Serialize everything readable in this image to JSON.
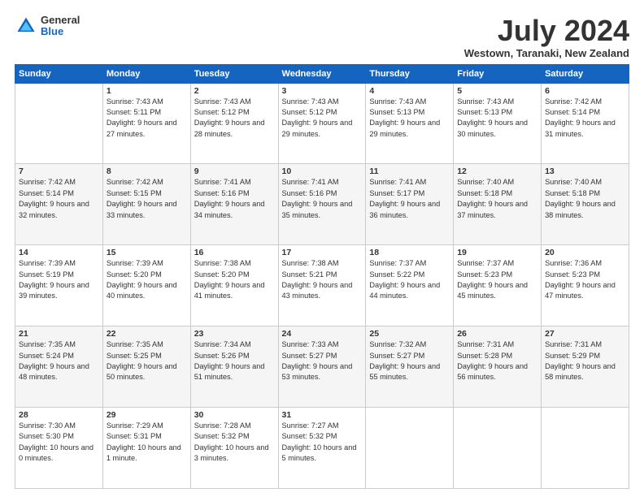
{
  "logo": {
    "general": "General",
    "blue": "Blue"
  },
  "title": "July 2024",
  "location": "Westown, Taranaki, New Zealand",
  "days_of_week": [
    "Sunday",
    "Monday",
    "Tuesday",
    "Wednesday",
    "Thursday",
    "Friday",
    "Saturday"
  ],
  "weeks": [
    [
      {
        "day": "",
        "sunrise": "",
        "sunset": "",
        "daylight": ""
      },
      {
        "day": "1",
        "sunrise": "Sunrise: 7:43 AM",
        "sunset": "Sunset: 5:11 PM",
        "daylight": "Daylight: 9 hours and 27 minutes."
      },
      {
        "day": "2",
        "sunrise": "Sunrise: 7:43 AM",
        "sunset": "Sunset: 5:12 PM",
        "daylight": "Daylight: 9 hours and 28 minutes."
      },
      {
        "day": "3",
        "sunrise": "Sunrise: 7:43 AM",
        "sunset": "Sunset: 5:12 PM",
        "daylight": "Daylight: 9 hours and 29 minutes."
      },
      {
        "day": "4",
        "sunrise": "Sunrise: 7:43 AM",
        "sunset": "Sunset: 5:13 PM",
        "daylight": "Daylight: 9 hours and 29 minutes."
      },
      {
        "day": "5",
        "sunrise": "Sunrise: 7:43 AM",
        "sunset": "Sunset: 5:13 PM",
        "daylight": "Daylight: 9 hours and 30 minutes."
      },
      {
        "day": "6",
        "sunrise": "Sunrise: 7:42 AM",
        "sunset": "Sunset: 5:14 PM",
        "daylight": "Daylight: 9 hours and 31 minutes."
      }
    ],
    [
      {
        "day": "7",
        "sunrise": "Sunrise: 7:42 AM",
        "sunset": "Sunset: 5:14 PM",
        "daylight": "Daylight: 9 hours and 32 minutes."
      },
      {
        "day": "8",
        "sunrise": "Sunrise: 7:42 AM",
        "sunset": "Sunset: 5:15 PM",
        "daylight": "Daylight: 9 hours and 33 minutes."
      },
      {
        "day": "9",
        "sunrise": "Sunrise: 7:41 AM",
        "sunset": "Sunset: 5:16 PM",
        "daylight": "Daylight: 9 hours and 34 minutes."
      },
      {
        "day": "10",
        "sunrise": "Sunrise: 7:41 AM",
        "sunset": "Sunset: 5:16 PM",
        "daylight": "Daylight: 9 hours and 35 minutes."
      },
      {
        "day": "11",
        "sunrise": "Sunrise: 7:41 AM",
        "sunset": "Sunset: 5:17 PM",
        "daylight": "Daylight: 9 hours and 36 minutes."
      },
      {
        "day": "12",
        "sunrise": "Sunrise: 7:40 AM",
        "sunset": "Sunset: 5:18 PM",
        "daylight": "Daylight: 9 hours and 37 minutes."
      },
      {
        "day": "13",
        "sunrise": "Sunrise: 7:40 AM",
        "sunset": "Sunset: 5:18 PM",
        "daylight": "Daylight: 9 hours and 38 minutes."
      }
    ],
    [
      {
        "day": "14",
        "sunrise": "Sunrise: 7:39 AM",
        "sunset": "Sunset: 5:19 PM",
        "daylight": "Daylight: 9 hours and 39 minutes."
      },
      {
        "day": "15",
        "sunrise": "Sunrise: 7:39 AM",
        "sunset": "Sunset: 5:20 PM",
        "daylight": "Daylight: 9 hours and 40 minutes."
      },
      {
        "day": "16",
        "sunrise": "Sunrise: 7:38 AM",
        "sunset": "Sunset: 5:20 PM",
        "daylight": "Daylight: 9 hours and 41 minutes."
      },
      {
        "day": "17",
        "sunrise": "Sunrise: 7:38 AM",
        "sunset": "Sunset: 5:21 PM",
        "daylight": "Daylight: 9 hours and 43 minutes."
      },
      {
        "day": "18",
        "sunrise": "Sunrise: 7:37 AM",
        "sunset": "Sunset: 5:22 PM",
        "daylight": "Daylight: 9 hours and 44 minutes."
      },
      {
        "day": "19",
        "sunrise": "Sunrise: 7:37 AM",
        "sunset": "Sunset: 5:23 PM",
        "daylight": "Daylight: 9 hours and 45 minutes."
      },
      {
        "day": "20",
        "sunrise": "Sunrise: 7:36 AM",
        "sunset": "Sunset: 5:23 PM",
        "daylight": "Daylight: 9 hours and 47 minutes."
      }
    ],
    [
      {
        "day": "21",
        "sunrise": "Sunrise: 7:35 AM",
        "sunset": "Sunset: 5:24 PM",
        "daylight": "Daylight: 9 hours and 48 minutes."
      },
      {
        "day": "22",
        "sunrise": "Sunrise: 7:35 AM",
        "sunset": "Sunset: 5:25 PM",
        "daylight": "Daylight: 9 hours and 50 minutes."
      },
      {
        "day": "23",
        "sunrise": "Sunrise: 7:34 AM",
        "sunset": "Sunset: 5:26 PM",
        "daylight": "Daylight: 9 hours and 51 minutes."
      },
      {
        "day": "24",
        "sunrise": "Sunrise: 7:33 AM",
        "sunset": "Sunset: 5:27 PM",
        "daylight": "Daylight: 9 hours and 53 minutes."
      },
      {
        "day": "25",
        "sunrise": "Sunrise: 7:32 AM",
        "sunset": "Sunset: 5:27 PM",
        "daylight": "Daylight: 9 hours and 55 minutes."
      },
      {
        "day": "26",
        "sunrise": "Sunrise: 7:31 AM",
        "sunset": "Sunset: 5:28 PM",
        "daylight": "Daylight: 9 hours and 56 minutes."
      },
      {
        "day": "27",
        "sunrise": "Sunrise: 7:31 AM",
        "sunset": "Sunset: 5:29 PM",
        "daylight": "Daylight: 9 hours and 58 minutes."
      }
    ],
    [
      {
        "day": "28",
        "sunrise": "Sunrise: 7:30 AM",
        "sunset": "Sunset: 5:30 PM",
        "daylight": "Daylight: 10 hours and 0 minutes."
      },
      {
        "day": "29",
        "sunrise": "Sunrise: 7:29 AM",
        "sunset": "Sunset: 5:31 PM",
        "daylight": "Daylight: 10 hours and 1 minute."
      },
      {
        "day": "30",
        "sunrise": "Sunrise: 7:28 AM",
        "sunset": "Sunset: 5:32 PM",
        "daylight": "Daylight: 10 hours and 3 minutes."
      },
      {
        "day": "31",
        "sunrise": "Sunrise: 7:27 AM",
        "sunset": "Sunset: 5:32 PM",
        "daylight": "Daylight: 10 hours and 5 minutes."
      },
      {
        "day": "",
        "sunrise": "",
        "sunset": "",
        "daylight": ""
      },
      {
        "day": "",
        "sunrise": "",
        "sunset": "",
        "daylight": ""
      },
      {
        "day": "",
        "sunrise": "",
        "sunset": "",
        "daylight": ""
      }
    ]
  ]
}
